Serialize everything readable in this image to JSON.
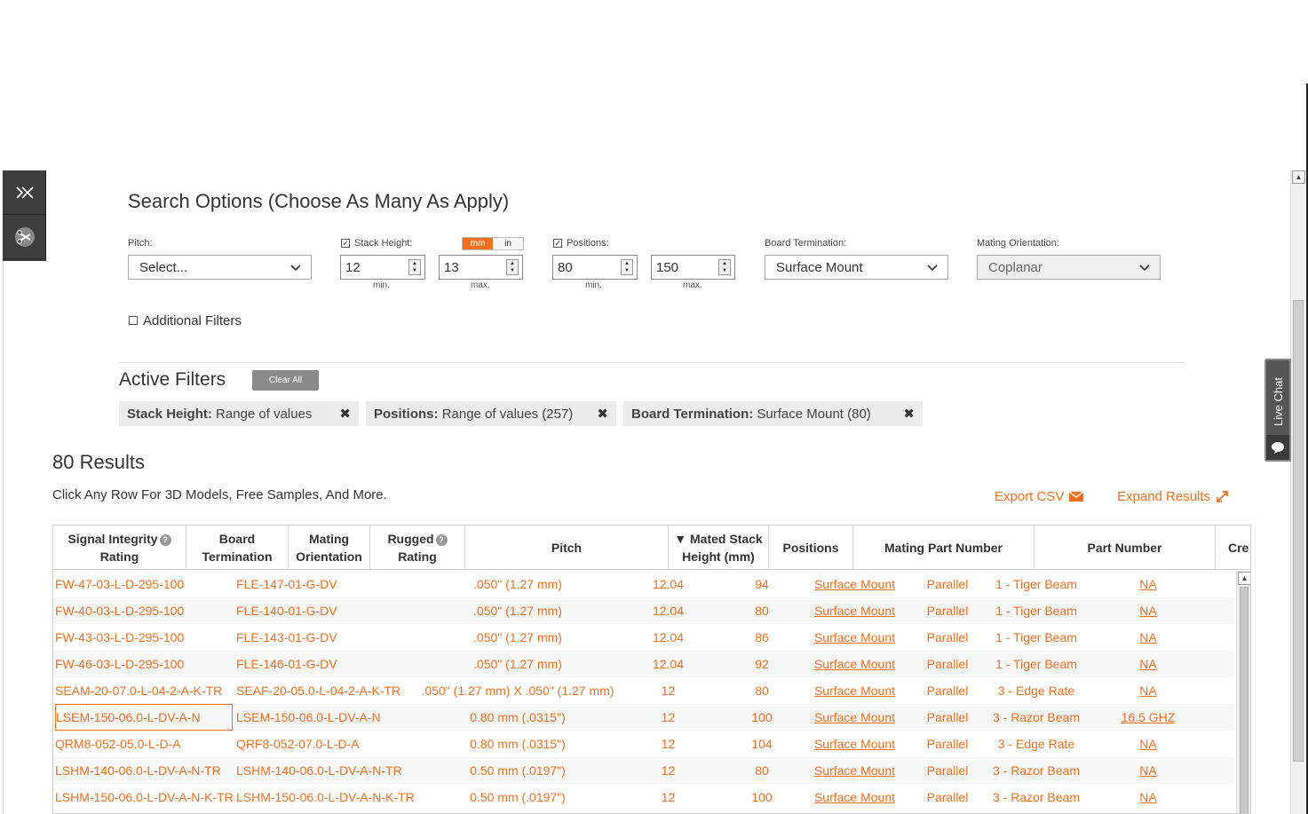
{
  "search": {
    "title": "Search Options (Choose As Many As Apply)",
    "pitch_label": "Pitch:",
    "pitch_value": "Select...",
    "stack_height_label": "Stack Height:",
    "unit_mm": "mm",
    "unit_in": "in",
    "stack_min": "12",
    "stack_max": "13",
    "positions_label": "Positions:",
    "positions_min": "80",
    "positions_max": "150",
    "min_label": "min.",
    "max_label": "max.",
    "board_term_label": "Board Termination:",
    "board_term_value": "Surface Mount",
    "mating_label": "Mating Orientation:",
    "mating_value": "Coplanar",
    "additional_filters": "Additional Filters"
  },
  "active_filters": {
    "title": "Active Filters",
    "clear_all": "Clear All",
    "chips": [
      {
        "key": "Stack Height:",
        "value": "Range of values"
      },
      {
        "key": "Positions:",
        "value": "Range of values (257)"
      },
      {
        "key": "Board Termination:",
        "value": "Surface Mount (80)"
      }
    ]
  },
  "results": {
    "count": "80 Results",
    "hint": "Click Any Row For 3D Models, Free Samples, And More.",
    "export": "Export CSV",
    "expand": "Expand Results"
  },
  "live_chat": "Live Chat",
  "table": {
    "headers": [
      {
        "l1": "Signal Integrity",
        "l2": "Rating"
      },
      {
        "l1": "Board",
        "l2": "Termination"
      },
      {
        "l1": "Mating",
        "l2": "Orientation"
      },
      {
        "l1": "Rugged",
        "l2": "Rating"
      },
      {
        "l1": "Pitch",
        "l2": ""
      },
      {
        "l1": "▼ Mated Stack",
        "l2": "Height (mm)"
      },
      {
        "l1": "Positions",
        "l2": ""
      },
      {
        "l1": "Mating Part Number",
        "l2": ""
      },
      {
        "l1": "Part Number",
        "l2": ""
      },
      {
        "l1": "Cre",
        "l2": ""
      }
    ],
    "rows": [
      [
        "FW-47-03-L-D-295-100",
        "FLE-147-01-G-DV",
        ".050\" (1.27 mm)",
        "12.04",
        "94",
        "Surface Mount",
        "Parallel",
        "1 - Tiger Beam",
        "NA"
      ],
      [
        "FW-40-03-L-D-295-100",
        "FLE-140-01-G-DV",
        ".050\" (1.27 mm)",
        "12.04",
        "80",
        "Surface Mount",
        "Parallel",
        "1 - Tiger Beam",
        "NA"
      ],
      [
        "FW-43-03-L-D-295-100",
        "FLE-143-01-G-DV",
        ".050\" (1.27 mm)",
        "12.04",
        "86",
        "Surface Mount",
        "Parallel",
        "1 - Tiger Beam",
        "NA"
      ],
      [
        "FW-46-03-L-D-295-100",
        "FLE-146-01-G-DV",
        ".050\" (1.27 mm)",
        "12.04",
        "92",
        "Surface Mount",
        "Parallel",
        "1 - Tiger Beam",
        "NA"
      ],
      [
        "SEAM-20-07.0-L-04-2-A-K-TR",
        "SEAF-20-05.0-L-04-2-A-K-TR",
        ".050\" (1.27 mm) X .050\" (1.27 mm)",
        "12",
        "80",
        "Surface Mount",
        "Parallel",
        "3 - Edge Rate",
        "NA"
      ],
      [
        "LSEM-150-06.0-L-DV-A-N",
        "LSEM-150-06.0-L-DV-A-N",
        "0.80 mm (.0315\")",
        "12",
        "100",
        "Surface Mount",
        "Parallel",
        "3 - Razor Beam",
        "16.5 GHZ"
      ],
      [
        "QRM8-052-05.0-L-D-A",
        "QRF8-052-07.0-L-D-A",
        "0.80 mm (.0315\")",
        "12",
        "104",
        "Surface Mount",
        "Parallel",
        "3 - Edge Rate",
        "NA"
      ],
      [
        "LSHM-140-06.0-L-DV-A-N-TR",
        "LSHM-140-06.0-L-DV-A-N-TR",
        "0.50 mm (.0197\")",
        "12",
        "80",
        "Surface Mount",
        "Parallel",
        "3 - Razor Beam",
        "NA"
      ],
      [
        "LSHM-150-06.0-L-DV-A-N-K-TR",
        "LSHM-150-06.0-L-DV-A-N-K-TR",
        "0.50 mm (.0197\")",
        "12",
        "100",
        "Surface Mount",
        "Parallel",
        "3 - Razor Beam",
        "NA"
      ]
    ]
  },
  "colors": {
    "accent": "#f37021",
    "chip_bg": "#ececec",
    "clear_btn": "#8a8a8a"
  }
}
